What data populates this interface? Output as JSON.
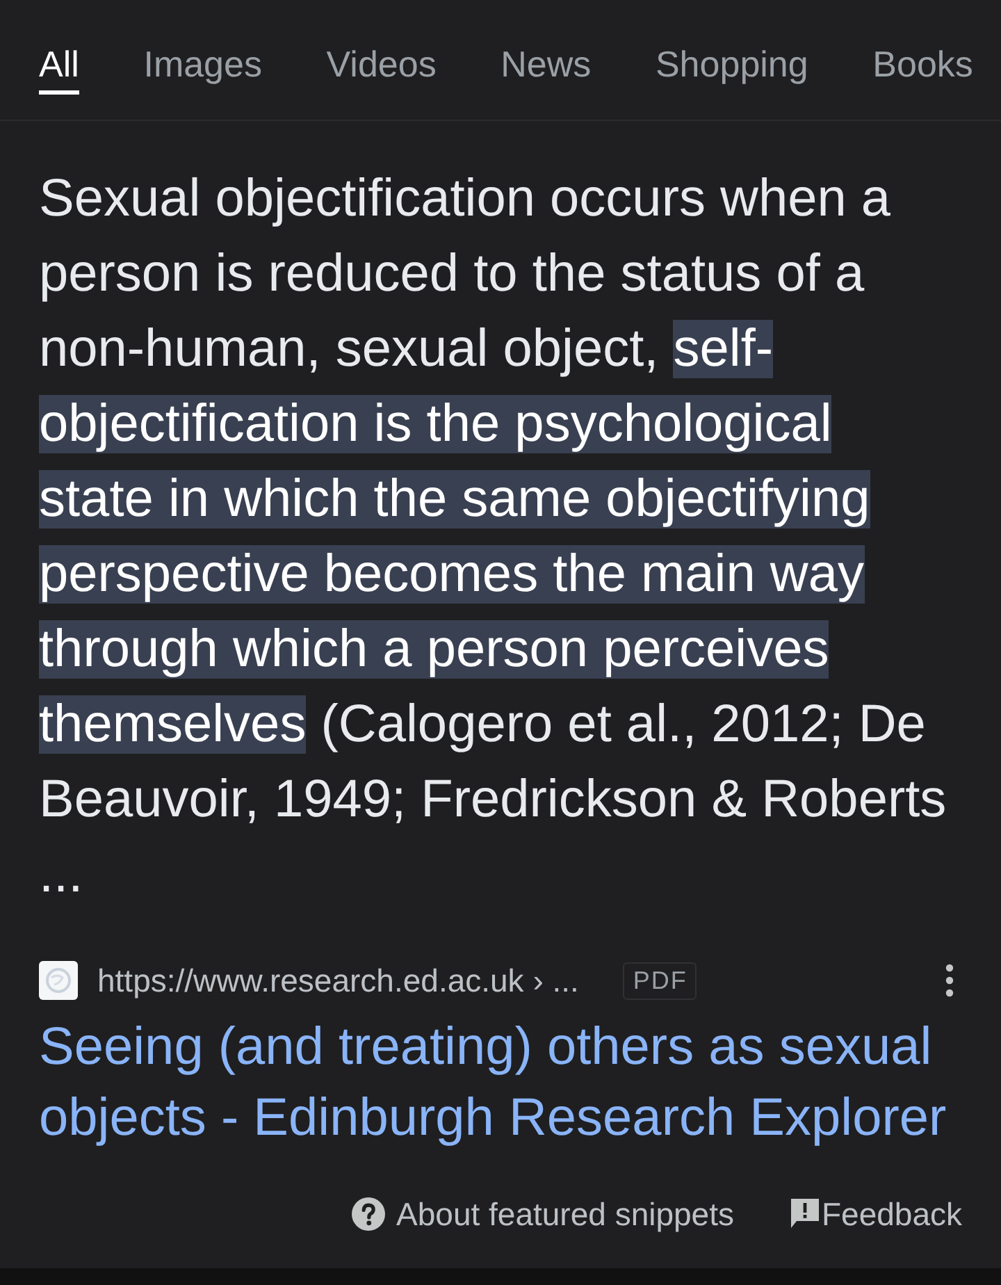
{
  "tabs": [
    {
      "label": "All",
      "selected": true
    },
    {
      "label": "Images",
      "selected": false
    },
    {
      "label": "Videos",
      "selected": false
    },
    {
      "label": "News",
      "selected": false
    },
    {
      "label": "Shopping",
      "selected": false
    },
    {
      "label": "Books",
      "selected": false
    }
  ],
  "snippet": {
    "text": "Sexual objectification occurs when a person is reduced to the status of a non-human, sexual object, **self-objectification is the psychological state in which the same objectifying perspective becomes the main way through which a person perceives themselves** (Calogero et al., 2012; De Beauvoir, 1949; Fredrickson & Roberts",
    "ellipsis": "..."
  },
  "source": {
    "url": "https://www.research.ed.ac.uk › ...",
    "badge": "PDF",
    "title": "Seeing (and treating) others as sexual objects - Edinburgh Research Explorer"
  },
  "footer": {
    "about": "About featured snippets",
    "feedback": "Feedback"
  }
}
